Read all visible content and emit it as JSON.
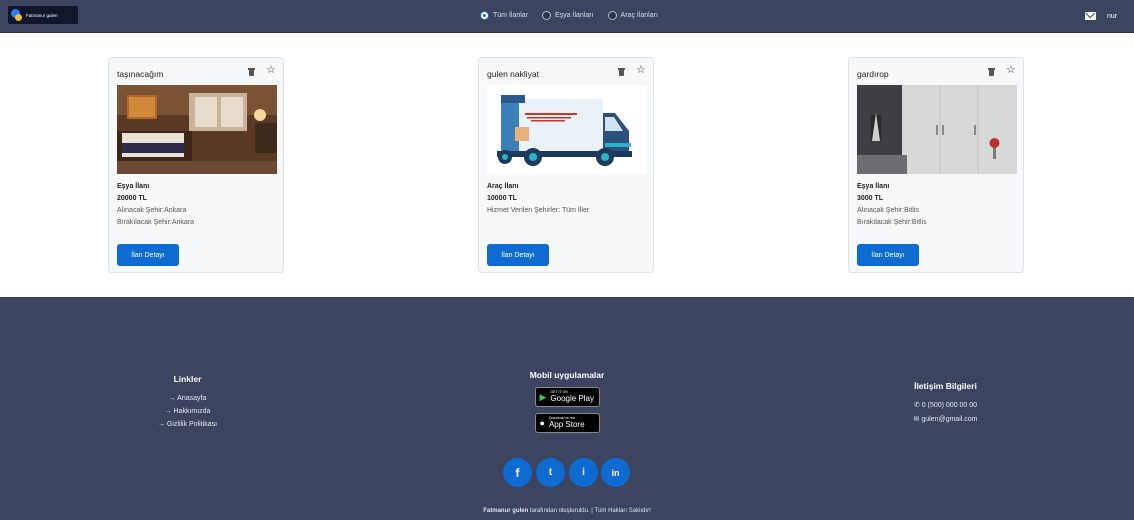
{
  "header": {
    "logo_text": "Fatmanur gulen",
    "filters": [
      {
        "label": "Tüm İlanlar",
        "selected": true
      },
      {
        "label": "Eşya İlanları",
        "selected": false
      },
      {
        "label": "Araç İlanları",
        "selected": false
      }
    ],
    "user": "nur"
  },
  "cards": [
    {
      "title": "taşınacağım",
      "type": "Eşya İlanı",
      "price": "20000 TL",
      "line3": "Alınacak Şehir:Ankara",
      "line4": "Bırakılacak Şehir:Ankara",
      "button": "İlan Detayı"
    },
    {
      "title": "gulen nakliyat",
      "type": "Araç İlanı",
      "price": "10000 TL",
      "line3": "Hizmet Verilen Şehirler: Tüm İller",
      "line4": "",
      "button": "İlan Detayı"
    },
    {
      "title": "gardırop",
      "type": "Eşya İlanı",
      "price": "3000 TL",
      "line3": "Alınacak Şehir:Bitlis",
      "line4": "Bırakılacak Şehir:Bitlis",
      "button": "İlan Detayı"
    }
  ],
  "footer": {
    "links_title": "Linkler",
    "links": [
      "→ Anasayfa",
      "→ Hakkımızda",
      "→ Gizlilik Politikası"
    ],
    "apps_title": "Mobil uygulamalar",
    "google_small": "GET IT ON",
    "google_big": "Google Play",
    "apple_small": "Download on the",
    "apple_big": "App Store",
    "contact_title": "İletişim Bilgileri",
    "phone": "0 (500) 000 00 00",
    "email": "gulen@gmail.com",
    "socials": [
      "f",
      "t",
      "i",
      "in"
    ],
    "credit_bold": "Fatmanur gulen",
    "credit_rest": " tarafından oluşturuldu. | Tüm Hakları Saklıdır!"
  },
  "colors": {
    "accent": "#0d6bd1",
    "header_bg": "#3c4460"
  }
}
